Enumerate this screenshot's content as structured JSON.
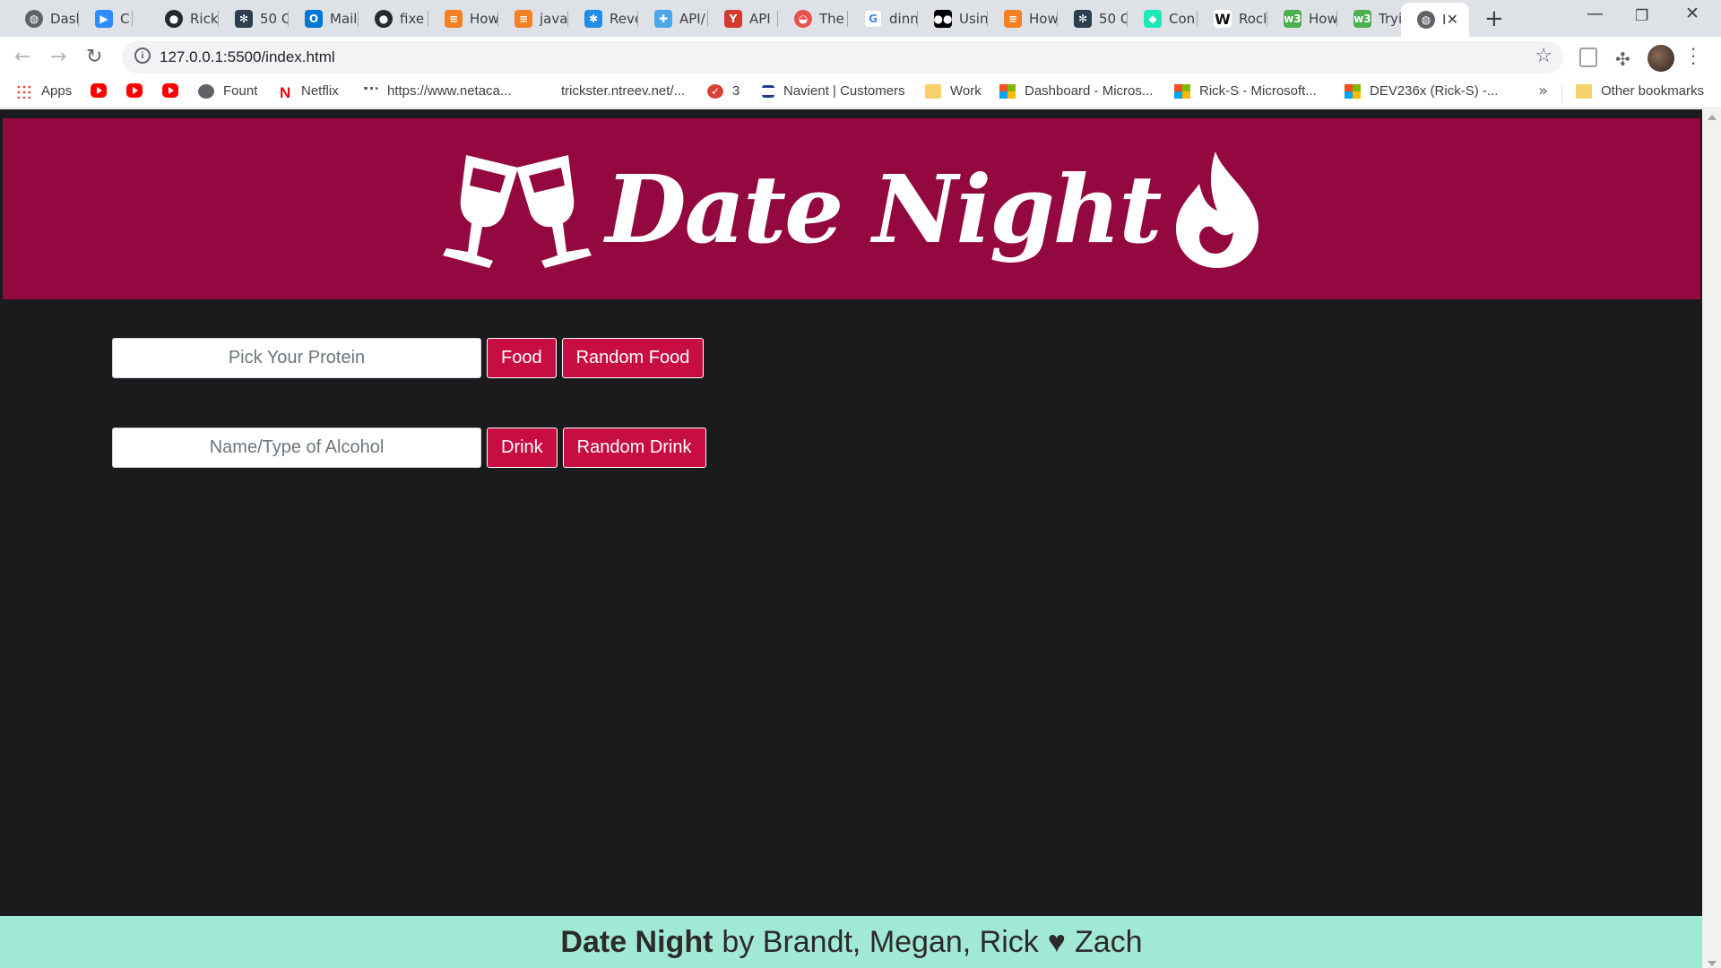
{
  "browser": {
    "tabs": [
      {
        "title": "Dasl",
        "icon": "globe-icon",
        "color": "#5f6368"
      },
      {
        "title": "C",
        "icon": "zoom-icon",
        "color": "#2d8cff"
      },
      {
        "title": "Rick",
        "icon": "github-icon",
        "color": "#24292e"
      },
      {
        "title": "50 C",
        "icon": "paw-icon",
        "color": "#2c3e50"
      },
      {
        "title": "Mail",
        "icon": "outlook-icon",
        "color": "#0078d4"
      },
      {
        "title": "fixe",
        "icon": "github-icon",
        "color": "#24292e"
      },
      {
        "title": "How",
        "icon": "stackoverflow-icon",
        "color": "#f48024"
      },
      {
        "title": "java",
        "icon": "stackoverflow-icon",
        "color": "#f48024"
      },
      {
        "title": "Reve",
        "icon": "puzzle-icon",
        "color": "#1f8ee6"
      },
      {
        "title": "API/",
        "icon": "api-icon",
        "color": "#4aa8e8"
      },
      {
        "title": "API",
        "icon": "cocktail-icon",
        "color": "#d33a2c"
      },
      {
        "title": "The",
        "icon": "food-icon",
        "color": "#e5534b"
      },
      {
        "title": "dinn",
        "icon": "google-icon",
        "color": "#4285f4"
      },
      {
        "title": "Usin",
        "icon": "medium-icon",
        "color": "#000000"
      },
      {
        "title": "How",
        "icon": "stackoverflow-icon",
        "color": "#f48024"
      },
      {
        "title": "50 C",
        "icon": "paw-icon",
        "color": "#2c3e50"
      },
      {
        "title": "Con",
        "icon": "codepen-icon",
        "color": "#1de9b6"
      },
      {
        "title": "Rocl",
        "icon": "w-icon",
        "color": "#111111"
      },
      {
        "title": "How",
        "icon": "w3-icon",
        "color": "#4caf50"
      },
      {
        "title": "Tryit",
        "icon": "w3-icon",
        "color": "#4caf50"
      },
      {
        "title": "I",
        "icon": "globe-icon",
        "color": "#5f6368"
      }
    ],
    "url": "127.0.0.1:5500/index.html",
    "bookmarks": [
      {
        "label": "Apps",
        "icon": "apps-grid-icon"
      },
      {
        "label": "",
        "icon": "youtube-icon"
      },
      {
        "label": "",
        "icon": "youtube-icon"
      },
      {
        "label": "",
        "icon": "youtube-icon"
      },
      {
        "label": "Fount",
        "icon": "globe-icon"
      },
      {
        "label": "Netflix",
        "icon": "netflix-icon"
      },
      {
        "label": "https://www.netaca...",
        "icon": "cisco-icon"
      },
      {
        "label": "trickster.ntreev.net/...",
        "icon": "blank-icon"
      },
      {
        "label": "3",
        "icon": "todoist-icon"
      },
      {
        "label": "Navient | Customers",
        "icon": "navient-icon"
      },
      {
        "label": "Work",
        "icon": "folder-icon"
      },
      {
        "label": "Dashboard - Micros...",
        "icon": "microsoft-icon"
      },
      {
        "label": "Rick-S - Microsoft...",
        "icon": "microsoft-icon"
      },
      {
        "label": "DEV236x (Rick-S) -...",
        "icon": "microsoft-icon"
      }
    ],
    "other_bookmarks": "Other bookmarks",
    "more": "»"
  },
  "page": {
    "brand": "Date Night",
    "food": {
      "placeholder": "Pick Your Protein",
      "button": "Food",
      "random_button": "Random Food"
    },
    "drink": {
      "placeholder": "Name/Type of Alcohol",
      "button": "Drink",
      "random_button": "Random Drink"
    },
    "footer": {
      "brand": "Date Night",
      "credits": "by Brandt, Megan, Rick",
      "heart": "♥",
      "last": "Zach"
    },
    "colors": {
      "header_bg": "#940840",
      "button_bg": "#c80d42",
      "page_bg": "#1b1a1d",
      "footer_bg": "#a2e9d5"
    }
  }
}
